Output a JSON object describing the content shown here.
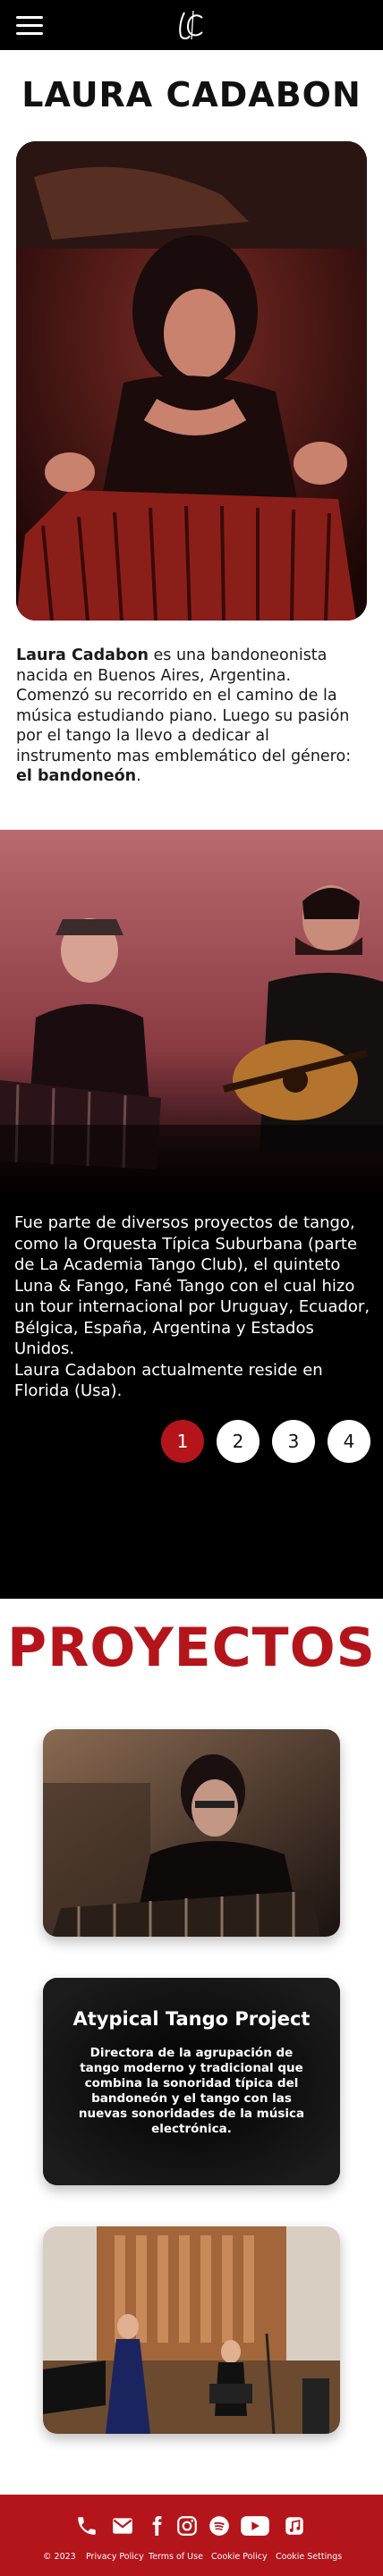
{
  "header": {
    "menu_icon": "hamburger-menu-icon",
    "logo_icon": "lc-monogram-logo"
  },
  "main": {
    "title": "LAURA CADABON",
    "bio": {
      "name": "Laura Cadabon",
      "text_before": " es una bandoneonista nacida en Buenos Aires, Argentina. Comenzó su recorrido en el camino de la música estudiando piano. Luego su pasión por el tango la llevo a dedicar al instrumento mas emblemático del género: ",
      "emphasis": "el bandoneón",
      "text_after": "."
    }
  },
  "slider": {
    "paragraph_1": "Fue parte de diversos proyectos de tango, como la Orquesta Típica Suburbana (parte de La Academia Tango Club), el quinteto Luna & Fango, Fané Tango con el cual hizo un tour internacional por Uruguay, Ecuador, Bélgica, España, Argentina y Estados Unidos.",
    "paragraph_2": "Laura Cadabon actualmente reside en Florida (Usa).",
    "pages": [
      "1",
      "2",
      "3",
      "4"
    ],
    "active_page": "1"
  },
  "proyectos": {
    "title": "PROYECTOS",
    "card2_title": "Atypical Tango Project",
    "card2_desc": "Directora de la agrupación de tango moderno y tradicional que combina la sonoridad típica del bandoneón y el tango con las nuevas sonoridades de la música electrónica."
  },
  "footer": {
    "icons": [
      "phone-icon",
      "email-icon",
      "facebook-icon",
      "instagram-icon",
      "spotify-icon",
      "youtube-icon",
      "music-note-icon"
    ],
    "copyright": "© 2023",
    "links": [
      "Privacy Policy",
      "Terms of Use",
      "Cookie Policy",
      "Cookie Settings"
    ]
  },
  "colors": {
    "accent_red": "#b4151b",
    "header_bg": "#000000",
    "dark_section_bg": "#000000"
  }
}
